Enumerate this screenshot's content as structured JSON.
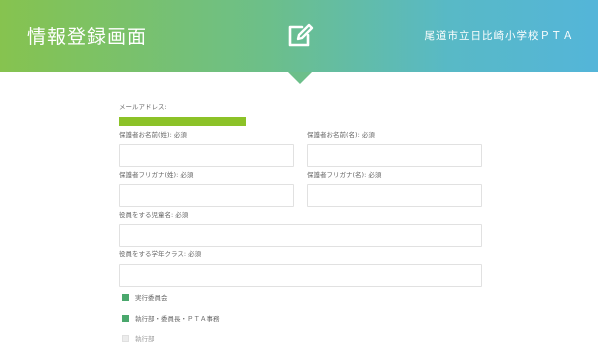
{
  "header": {
    "title": "情報登録画面",
    "organization": "尾道市立日比崎小学校ＰＴＡ",
    "edit_icon": "edit-icon",
    "gradient_start": "#86c34f",
    "gradient_end": "#54b5d9"
  },
  "form": {
    "email_label": "メールアドレス:",
    "guardian_last_name_label": "保護者お名前(姓): 必須",
    "guardian_first_name_label": "保護者お名前(名): 必須",
    "guardian_last_kana_label": "保護者フリガナ(姓): 必須",
    "guardian_first_kana_label": "保護者フリガナ(名): 必須",
    "child_name_label": "役員をする児童名: 必須",
    "child_class_label": "役員をする学年クラス: 必須",
    "roles": [
      {
        "label": "実行委員会",
        "checked": true
      },
      {
        "label": "執行部・委員長・ＰＴＡ事務",
        "checked": true
      },
      {
        "label": "執行部",
        "checked": false
      }
    ],
    "checked_color": "#4aa86d",
    "email_highlight_color": "#8cc228"
  }
}
